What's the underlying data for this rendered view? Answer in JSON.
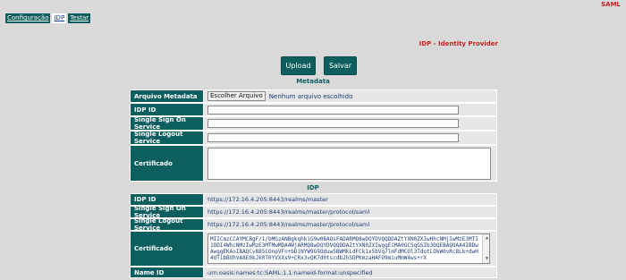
{
  "app_title": "SAML",
  "nav": [
    {
      "label": "Configuração"
    },
    {
      "label": "IDP"
    },
    {
      "label": "Testar"
    }
  ],
  "section_title": "IDP - Identity Provider",
  "buttons": {
    "upload": "Upload",
    "save": "Salvar"
  },
  "metadata": {
    "title": "Metadata",
    "file_label": "Arquivo Metadata",
    "file_button": "Escolher Arquivo",
    "file_status": "Nenhum arquivo escolhido",
    "idp_id_label": "IDP ID",
    "sso_label": "Single Sign On Service",
    "slo_label": "Single Logout Service",
    "cert_label": "Certificado"
  },
  "idp": {
    "title": "IDP",
    "rows": [
      {
        "label": "IDP ID",
        "value": "https://172.16.4.205:8443/realms/master"
      },
      {
        "label": "Single Sign On Service",
        "value": "https://172.16.4.205:8443/realms/master/protocol/saml"
      },
      {
        "label": "Single Logout Service",
        "value": "https://172.16.4.205:8443/realms/master/protocol/saml"
      }
    ],
    "cert_label": "Certificado",
    "cert_value": "MIICmzCCAYMCBgF/1/bMGzANBgkqhkiG9w0BAQsFADARMQ8wDQYDVQQDDAZtYXN0ZXIwHhcNMjIwMzE3MTI1ODI4WhcNMzIwMzE3MTMwMDA4WjARMQ8wDQYDVQQDDAZtYXN0ZXIwggEiMA0GCSqGSIb3DQEBAQUAA4IBDwAwggEKAoIBAQCv885COnpVFn+bDiNYW9G9Oduw5BWMkLdFCk1x5bVq7lmFdMCOl3TdotLOkW0vRc8Lk+dwH4UTibBUhVA8E0kJk0T0YVXXs9+CRx3vQK7d0tscdb2hSDPKmzaHAFO9miuMmW4ws+rX",
    "nameid_label": "Name ID",
    "nameid_value": "urn:oasis:names:tc:SAML:1.1:nameid-format:unspecified"
  }
}
